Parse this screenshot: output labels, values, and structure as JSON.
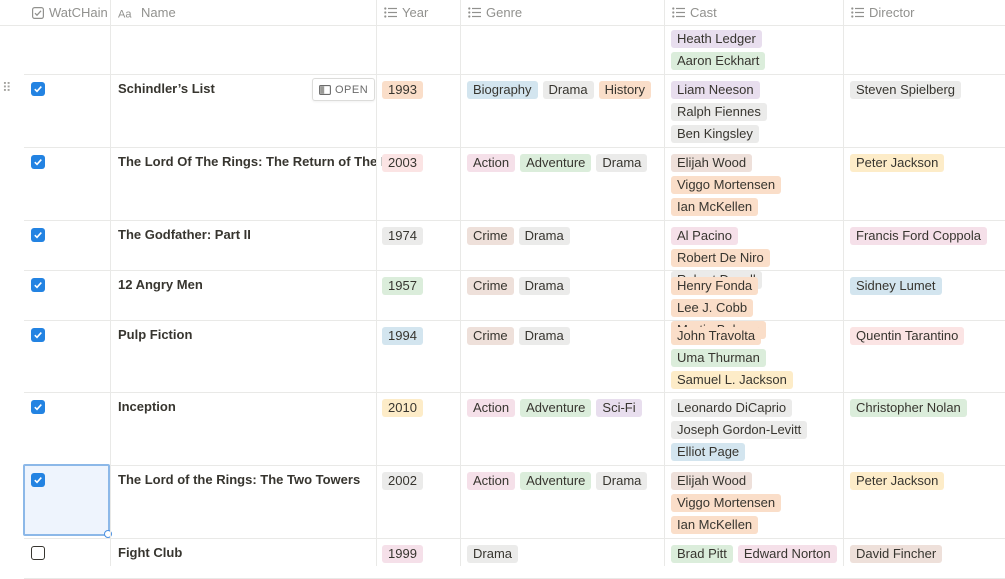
{
  "columns": [
    {
      "label": "WatCHain",
      "icon": "checkbox-icon"
    },
    {
      "label": "Name",
      "icon": "text-aa-icon"
    },
    {
      "label": "Year",
      "icon": "list-icon"
    },
    {
      "label": "Genre",
      "icon": "list-icon"
    },
    {
      "label": "Cast",
      "icon": "list-icon"
    },
    {
      "label": "Director",
      "icon": "list-icon"
    }
  ],
  "open_label": "OPEN",
  "colors": {
    "gray": "#ebebea",
    "orange": "#fadec9",
    "red": "#fbe4e4",
    "green": "#dbeddb",
    "blue": "#d3e5ef",
    "purple": "#e8deee",
    "pink": "#f5e0e9",
    "yellow": "#fdecc8",
    "brown": "#eee0da",
    "checkbox_blue": "#2383e2"
  },
  "rows": [
    {
      "checked": null,
      "name": "",
      "year": null,
      "genre": [],
      "cast": [
        {
          "text": "Heath Ledger",
          "color": "purple"
        },
        {
          "text": "Aaron Eckhart",
          "color": "green"
        }
      ],
      "director": []
    },
    {
      "checked": true,
      "name": "Schindler’s List",
      "year": {
        "text": "1993",
        "color": "orange"
      },
      "genre": [
        {
          "text": "Biography",
          "color": "blue"
        },
        {
          "text": "Drama",
          "color": "gray"
        },
        {
          "text": "History",
          "color": "orange"
        }
      ],
      "cast": [
        {
          "text": "Liam Neeson",
          "color": "purple"
        },
        {
          "text": "Ralph Fiennes",
          "color": "gray"
        },
        {
          "text": "Ben Kingsley",
          "color": "gray"
        }
      ],
      "director": [
        {
          "text": "Steven Spielberg",
          "color": "gray"
        }
      ]
    },
    {
      "checked": true,
      "name": "The Lord Of The Rings: The Return of The King",
      "year": {
        "text": "2003",
        "color": "red"
      },
      "genre": [
        {
          "text": "Action",
          "color": "pink"
        },
        {
          "text": "Adventure",
          "color": "green"
        },
        {
          "text": "Drama",
          "color": "gray"
        }
      ],
      "cast": [
        {
          "text": "Elijah Wood",
          "color": "brown"
        },
        {
          "text": "Viggo Mortensen",
          "color": "orange"
        },
        {
          "text": "Ian McKellen",
          "color": "orange"
        }
      ],
      "director": [
        {
          "text": "Peter Jackson",
          "color": "yellow"
        }
      ]
    },
    {
      "checked": true,
      "name": "The Godfather: Part II",
      "year": {
        "text": "1974",
        "color": "gray"
      },
      "genre": [
        {
          "text": "Crime",
          "color": "brown"
        },
        {
          "text": "Drama",
          "color": "gray"
        }
      ],
      "cast": [
        {
          "text": "Al Pacino",
          "color": "pink"
        },
        {
          "text": "Robert De Niro",
          "color": "orange"
        },
        {
          "text": "Robert Duvall",
          "color": "gray"
        }
      ],
      "director": [
        {
          "text": "Francis Ford Coppola",
          "color": "pink"
        }
      ]
    },
    {
      "checked": true,
      "name": "12 Angry Men",
      "year": {
        "text": "1957",
        "color": "green"
      },
      "genre": [
        {
          "text": "Crime",
          "color": "brown"
        },
        {
          "text": "Drama",
          "color": "gray"
        }
      ],
      "cast": [
        {
          "text": "Henry Fonda",
          "color": "orange"
        },
        {
          "text": "Lee J. Cobb",
          "color": "orange"
        },
        {
          "text": "Martin Balsam",
          "color": "orange"
        }
      ],
      "director": [
        {
          "text": "Sidney Lumet",
          "color": "blue"
        }
      ]
    },
    {
      "checked": true,
      "name": "Pulp Fiction",
      "year": {
        "text": "1994",
        "color": "blue"
      },
      "genre": [
        {
          "text": "Crime",
          "color": "brown"
        },
        {
          "text": "Drama",
          "color": "gray"
        }
      ],
      "cast": [
        {
          "text": "John Travolta",
          "color": "orange"
        },
        {
          "text": "Uma Thurman",
          "color": "green"
        },
        {
          "text": "Samuel L. Jackson",
          "color": "yellow"
        }
      ],
      "director": [
        {
          "text": "Quentin Tarantino",
          "color": "red"
        }
      ]
    },
    {
      "checked": true,
      "name": "Inception",
      "year": {
        "text": "2010",
        "color": "yellow"
      },
      "genre": [
        {
          "text": "Action",
          "color": "pink"
        },
        {
          "text": "Adventure",
          "color": "green"
        },
        {
          "text": "Sci-Fi",
          "color": "purple"
        }
      ],
      "cast": [
        {
          "text": "Leonardo DiCaprio",
          "color": "gray"
        },
        {
          "text": "Joseph Gordon-Levitt",
          "color": "gray"
        },
        {
          "text": "Elliot Page",
          "color": "blue"
        }
      ],
      "director": [
        {
          "text": "Christopher Nolan",
          "color": "green"
        }
      ]
    },
    {
      "checked": true,
      "name": "The Lord of the Rings: The Two Towers",
      "year": {
        "text": "2002",
        "color": "gray"
      },
      "genre": [
        {
          "text": "Action",
          "color": "pink"
        },
        {
          "text": "Adventure",
          "color": "green"
        },
        {
          "text": "Drama",
          "color": "gray"
        }
      ],
      "cast": [
        {
          "text": "Elijah Wood",
          "color": "brown"
        },
        {
          "text": "Viggo Mortensen",
          "color": "orange"
        },
        {
          "text": "Ian McKellen",
          "color": "orange"
        }
      ],
      "director": [
        {
          "text": "Peter Jackson",
          "color": "yellow"
        }
      ]
    },
    {
      "checked": false,
      "name": "Fight Club",
      "year": {
        "text": "1999",
        "color": "pink"
      },
      "genre": [
        {
          "text": "Drama",
          "color": "gray"
        }
      ],
      "cast": [
        {
          "text": "Brad Pitt",
          "color": "green"
        },
        {
          "text": "Edward Norton",
          "color": "pink"
        }
      ],
      "director": [
        {
          "text": "David Fincher",
          "color": "brown"
        }
      ]
    }
  ]
}
